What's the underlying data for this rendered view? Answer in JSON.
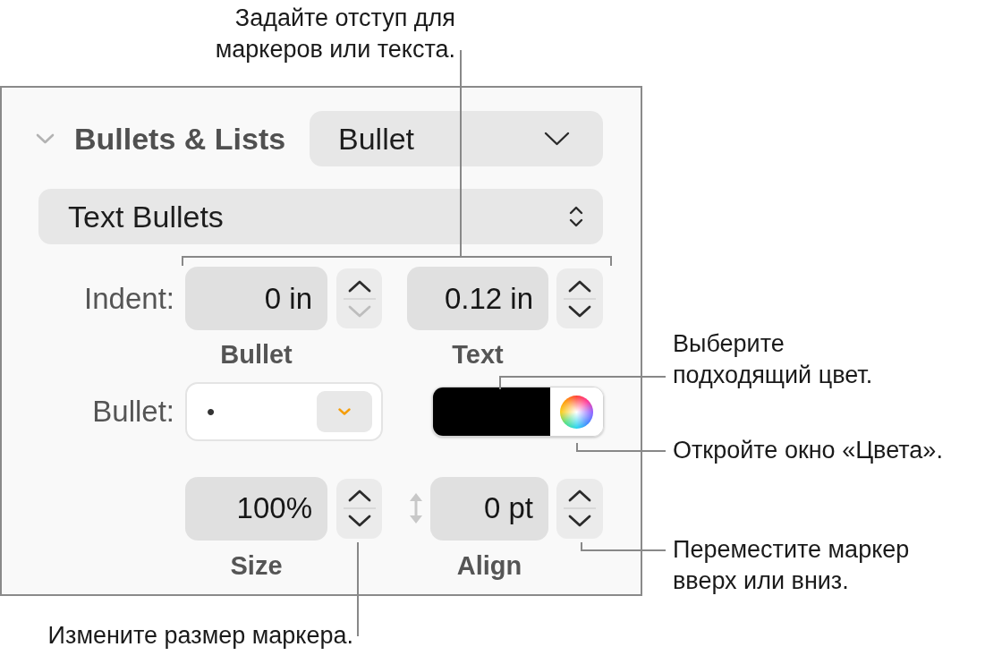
{
  "callouts": [
    {
      "kind": "indent",
      "text": "Задайте отступ для маркеров или текста."
    },
    {
      "kind": "color",
      "text": "Выберите подходящий цвет."
    },
    {
      "kind": "color_window",
      "text": "Откройте окно «Цвета»."
    },
    {
      "kind": "align",
      "text": "Переместите маркер вверх или вниз."
    },
    {
      "kind": "size",
      "text": "Измените размер маркера."
    }
  ],
  "inspector": {
    "section": {
      "title": "Bullets & Lists",
      "expanded": true,
      "list_style_popup": {
        "value": "Bullet"
      }
    },
    "bullet_type_popup": {
      "value": "Text Bullets"
    },
    "indent": {
      "label": "Indent:",
      "fields": [
        {
          "value": "0 in",
          "caption": "Bullet",
          "stepper": {
            "up_disabled": false,
            "down_disabled": true
          }
        },
        {
          "value": "0.12 in",
          "caption": "Text",
          "stepper": {
            "up_disabled": false,
            "down_disabled": false
          }
        }
      ]
    },
    "bullet": {
      "label": "Bullet:",
      "value": "•",
      "color_well": {
        "color": "#000000"
      }
    },
    "size_align": {
      "fields": [
        {
          "value": "100%",
          "caption": "Size",
          "stepper": {
            "up_disabled": false,
            "down_disabled": false
          }
        },
        {
          "value": "0 pt",
          "caption": "Align",
          "stepper": {
            "up_disabled": false,
            "down_disabled": false
          }
        }
      ]
    }
  }
}
